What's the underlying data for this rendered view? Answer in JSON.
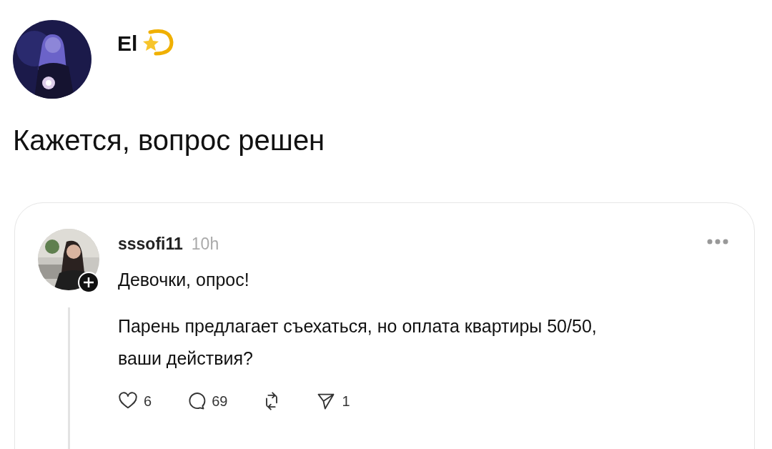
{
  "post": {
    "author": "El",
    "text": "Кажется, вопрос решен"
  },
  "quoted": {
    "author": "sssofi11",
    "time": "10h",
    "title": "Девочки, опрос!",
    "body": "Парень предлагает съехаться, но оплата квартиры 50/50, ваши действия?",
    "actions": [
      {
        "kind": "like",
        "count": "6"
      },
      {
        "kind": "reply",
        "count": "69"
      },
      {
        "kind": "repost"
      },
      {
        "kind": "share",
        "count": "1"
      }
    ]
  }
}
